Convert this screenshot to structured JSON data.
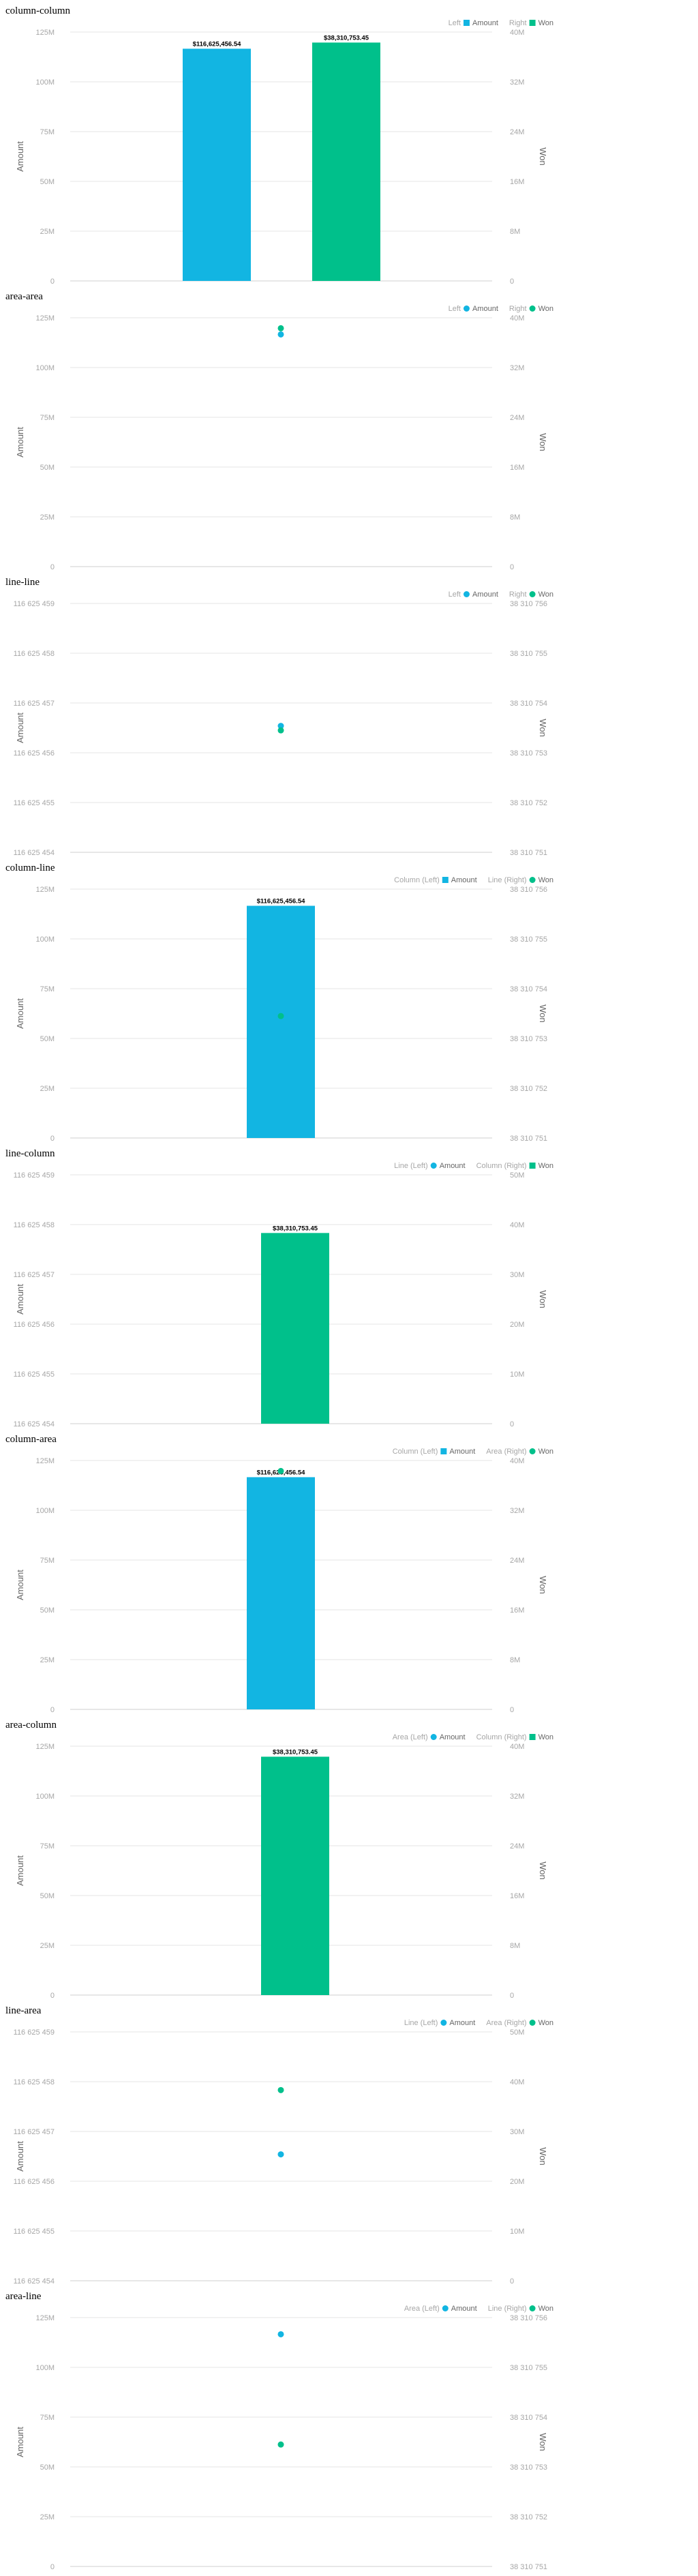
{
  "colors": {
    "amount": "#12B5E2",
    "won": "#00C08B",
    "grid": "#e6e6e6",
    "baseline": "#cfcfcf"
  },
  "left_axis_title": "Amount",
  "right_axis_title": "Won",
  "chart_data": [
    {
      "title": "column-column",
      "type": "bar",
      "legend": {
        "left_label": "Left",
        "right_label": "Right",
        "left_series": "Amount",
        "right_series": "Won"
      },
      "left_series": {
        "name": "Amount",
        "type": "column",
        "value": 116625456.54,
        "label": "$116,625,456.54"
      },
      "right_series": {
        "name": "Won",
        "type": "column",
        "value": 38310753.45,
        "label": "$38,310,753.45"
      },
      "left_ticks": [
        "0",
        "25M",
        "50M",
        "75M",
        "100M",
        "125M"
      ],
      "right_ticks": [
        "0",
        "8M",
        "16M",
        "24M",
        "32M",
        "40M"
      ],
      "left_range": [
        0,
        125000000
      ],
      "right_range": [
        0,
        40000000
      ]
    },
    {
      "title": "area-area",
      "type": "area",
      "legend": {
        "left_label": "Left",
        "right_label": "Right",
        "left_series": "Amount",
        "right_series": "Won"
      },
      "left_series": {
        "name": "Amount",
        "type": "area",
        "value": 116625456.54,
        "label": ""
      },
      "right_series": {
        "name": "Won",
        "type": "area",
        "value": 38310753.45,
        "label": ""
      },
      "left_ticks": [
        "0",
        "25M",
        "50M",
        "75M",
        "100M",
        "125M"
      ],
      "right_ticks": [
        "0",
        "8M",
        "16M",
        "24M",
        "32M",
        "40M"
      ],
      "left_range": [
        0,
        125000000
      ],
      "right_range": [
        0,
        40000000
      ]
    },
    {
      "title": "line-line",
      "type": "line",
      "legend": {
        "left_label": "Left",
        "right_label": "Right",
        "left_series": "Amount",
        "right_series": "Won"
      },
      "left_series": {
        "name": "Amount",
        "type": "line",
        "value": 116625456.54,
        "label": ""
      },
      "right_series": {
        "name": "Won",
        "type": "line",
        "value": 38310753.45,
        "label": ""
      },
      "left_ticks": [
        "116 625 454",
        "116 625 455",
        "116 625 456",
        "116 625 457",
        "116 625 458",
        "116 625 459"
      ],
      "right_ticks": [
        "38 310 751",
        "38 310 752",
        "38 310 753",
        "38 310 754",
        "38 310 755",
        "38 310 756"
      ],
      "left_range": [
        116625454,
        116625459
      ],
      "right_range": [
        38310751,
        38310756
      ]
    },
    {
      "title": "column-line",
      "type": "bar",
      "legend": {
        "left_label": "Column (Left)",
        "right_label": "Line (Right)",
        "left_series": "Amount",
        "right_series": "Won"
      },
      "left_series": {
        "name": "Amount",
        "type": "column",
        "value": 116625456.54,
        "label": "$116,625,456.54"
      },
      "right_series": {
        "name": "Won",
        "type": "line",
        "value": 38310753.45,
        "label": ""
      },
      "left_ticks": [
        "0",
        "25M",
        "50M",
        "75M",
        "100M",
        "125M"
      ],
      "right_ticks": [
        "38 310 751",
        "38 310 752",
        "38 310 753",
        "38 310 754",
        "38 310 755",
        "38 310 756"
      ],
      "left_range": [
        0,
        125000000
      ],
      "right_range": [
        38310751,
        38310756
      ]
    },
    {
      "title": "line-column",
      "type": "bar",
      "legend": {
        "left_label": "Line (Left)",
        "right_label": "Column (Right)",
        "left_series": "Amount",
        "right_series": "Won"
      },
      "left_series": {
        "name": "Amount",
        "type": "line",
        "value": 116625456.54,
        "label": ""
      },
      "right_series": {
        "name": "Won",
        "type": "column",
        "value": 38310753.45,
        "label": "$38,310,753.45"
      },
      "left_ticks": [
        "116 625 454",
        "116 625 455",
        "116 625 456",
        "116 625 457",
        "116 625 458",
        "116 625 459"
      ],
      "right_ticks": [
        "0",
        "10M",
        "20M",
        "30M",
        "40M",
        "50M"
      ],
      "left_range": [
        116625454,
        116625459
      ],
      "right_range": [
        0,
        50000000
      ]
    },
    {
      "title": "column-area",
      "type": "bar",
      "legend": {
        "left_label": "Column (Left)",
        "right_label": "Area (Right)",
        "left_series": "Amount",
        "right_series": "Won"
      },
      "left_series": {
        "name": "Amount",
        "type": "column",
        "value": 116625456.54,
        "label": "$116,625,456.54"
      },
      "right_series": {
        "name": "Won",
        "type": "area",
        "value": 38310753.45,
        "label": ""
      },
      "left_ticks": [
        "0",
        "25M",
        "50M",
        "75M",
        "100M",
        "125M"
      ],
      "right_ticks": [
        "0",
        "8M",
        "16M",
        "24M",
        "32M",
        "40M"
      ],
      "left_range": [
        0,
        125000000
      ],
      "right_range": [
        0,
        40000000
      ]
    },
    {
      "title": "area-column",
      "type": "bar",
      "legend": {
        "left_label": "Area (Left)",
        "right_label": "Column (Right)",
        "left_series": "Amount",
        "right_series": "Won"
      },
      "left_series": {
        "name": "Amount",
        "type": "area",
        "value": 116625456.54,
        "label": ""
      },
      "right_series": {
        "name": "Won",
        "type": "column",
        "value": 38310753.45,
        "label": "$38,310,753.45"
      },
      "left_ticks": [
        "0",
        "25M",
        "50M",
        "75M",
        "100M",
        "125M"
      ],
      "right_ticks": [
        "0",
        "8M",
        "16M",
        "24M",
        "32M",
        "40M"
      ],
      "left_range": [
        0,
        125000000
      ],
      "right_range": [
        0,
        40000000
      ]
    },
    {
      "title": "line-area",
      "type": "line",
      "legend": {
        "left_label": "Line (Left)",
        "right_label": "Area (Right)",
        "left_series": "Amount",
        "right_series": "Won"
      },
      "left_series": {
        "name": "Amount",
        "type": "line",
        "value": 116625456.54,
        "label": ""
      },
      "right_series": {
        "name": "Won",
        "type": "area",
        "value": 38310753.45,
        "label": ""
      },
      "left_ticks": [
        "116 625 454",
        "116 625 455",
        "116 625 456",
        "116 625 457",
        "116 625 458",
        "116 625 459"
      ],
      "right_ticks": [
        "0",
        "10M",
        "20M",
        "30M",
        "40M",
        "50M"
      ],
      "left_range": [
        116625454,
        116625459
      ],
      "right_range": [
        0,
        50000000
      ]
    },
    {
      "title": "area-line",
      "type": "area",
      "legend": {
        "left_label": "Area (Left)",
        "right_label": "Line (Right)",
        "left_series": "Amount",
        "right_series": "Won"
      },
      "left_series": {
        "name": "Amount",
        "type": "area",
        "value": 116625456.54,
        "label": ""
      },
      "right_series": {
        "name": "Won",
        "type": "line",
        "value": 38310753.45,
        "label": ""
      },
      "left_ticks": [
        "0",
        "25M",
        "50M",
        "75M",
        "100M",
        "125M"
      ],
      "right_ticks": [
        "38 310 751",
        "38 310 752",
        "38 310 753",
        "38 310 754",
        "38 310 755",
        "38 310 756"
      ],
      "left_range": [
        0,
        125000000
      ],
      "right_range": [
        38310751,
        38310756
      ]
    }
  ]
}
